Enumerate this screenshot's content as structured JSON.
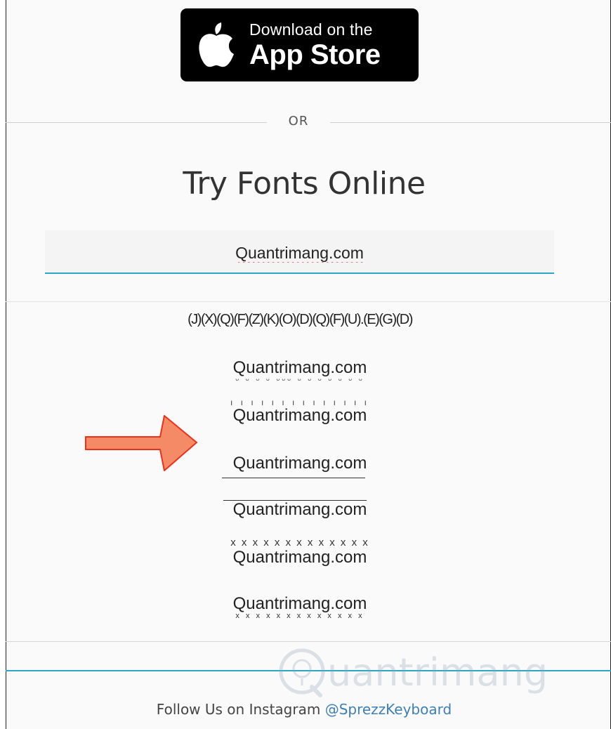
{
  "app_store": {
    "small_label": "Download on the",
    "big_label": "App Store"
  },
  "divider": {
    "label": "OR"
  },
  "title": "Try Fonts Online",
  "input": {
    "value": "Quantrimang.com"
  },
  "results": [
    {
      "text": "(J)(X)(Q)(F)(Z)(K)(O)(D)(Q)(F)(U).(E)(G)(D)"
    },
    {
      "text": "Quantrimang.com",
      "marks": "ᵕ ᵕ ᵕ ᵕ ᵕᵕᵕ ᵕ ᵕ ᵕ ᵕ  ᵕ ᵕ ᵕ"
    },
    {
      "text": "Quantrimang.com",
      "marks": "ı ı ı ı ı ı ı ı ı ı ı  ı ı ı"
    },
    {
      "text": "Quantrimang.com"
    },
    {
      "text": "Quantrimang.com"
    },
    {
      "text": "Quantrimang.com",
      "marks": "x x x x x x x x x x  x x x"
    },
    {
      "text": "Quantrimang.com",
      "marks": "x x x x x x x x x x  x x x"
    }
  ],
  "watermark": {
    "text": "uantrimang"
  },
  "footer": {
    "prefix": "Follow Us on Instagram ",
    "handle": "@SprezzKeyboard"
  },
  "colors": {
    "accent": "#2aa7c6",
    "link": "#3e7fb5",
    "arrow_fill": "#f58a66",
    "arrow_stroke": "#e8321a"
  },
  "icons": [
    "apple-icon",
    "right-arrow-icon",
    "lightbulb-icon"
  ]
}
